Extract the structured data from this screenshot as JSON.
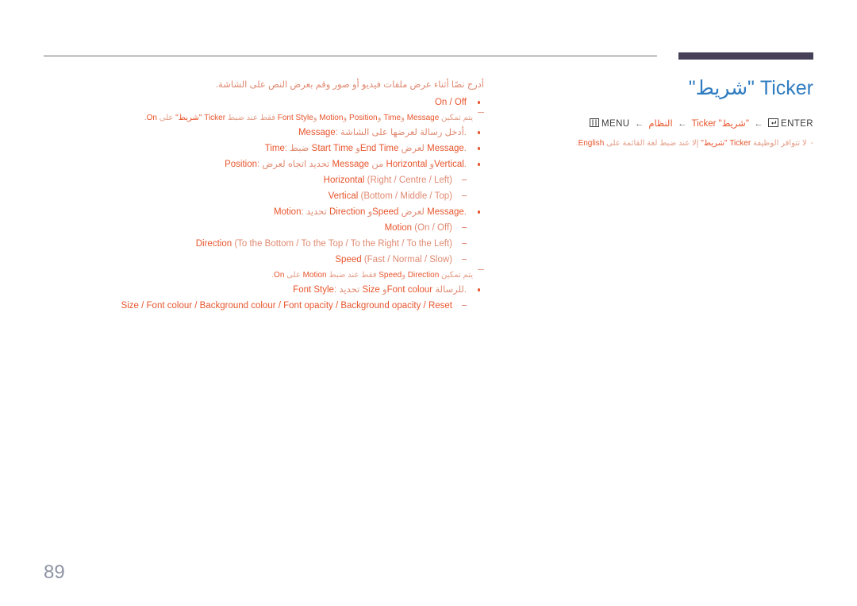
{
  "topbar": {
    "rule_name": "horizontal-rule",
    "tab_marker_color": "#464159",
    "rule_color": "#6f6b78"
  },
  "header": {
    "title": "Ticker \"شريط\"",
    "title_color": "#2f7cc0",
    "breadcrumb": {
      "menu_icon": "menu-icon",
      "menu_label": "MENU",
      "arrow": "←",
      "item_system": "النظام",
      "item_ticker": "Ticker \"شريط\"",
      "enter_icon": "enter-icon",
      "enter_label": "ENTER"
    },
    "note": {
      "dash": "-",
      "text_before": "لا تتوافر الوظيفة",
      "term_ticker": "Ticker \"شريط\"",
      "text_middle": "إلا عند ضبط لغة القائمة على",
      "term_english": "English",
      "text_after": "."
    }
  },
  "main": {
    "intro": "أدرج نصًا أثناء عرض ملفات فيديو أو صور وقم بعرض النص على الشاشة.",
    "items": [
      {
        "kind": "bullet",
        "label": "On / Off",
        "label_highlight": true,
        "text": ""
      },
      {
        "kind": "subnote",
        "segments": [
          {
            "t": "يتم تمكين ",
            "hl": false
          },
          {
            "t": "Message",
            "hl": true
          },
          {
            "t": " و",
            "hl": false
          },
          {
            "t": "Time",
            "hl": true
          },
          {
            "t": " و",
            "hl": false
          },
          {
            "t": "Position",
            "hl": true
          },
          {
            "t": " و",
            "hl": false
          },
          {
            "t": "Motion",
            "hl": true
          },
          {
            "t": " و",
            "hl": false
          },
          {
            "t": "Font Style",
            "hl": true
          },
          {
            "t": " فقط عند ضبط ",
            "hl": false
          },
          {
            "t": "Ticker \"شريط\"",
            "hl": true
          },
          {
            "t": " على ",
            "hl": false
          },
          {
            "t": "On",
            "hl": true
          },
          {
            "t": ".",
            "hl": false
          }
        ]
      },
      {
        "kind": "bullet",
        "segments": [
          {
            "t": "Message",
            "hl": true
          },
          {
            "t": ": أدخل رسالة لعرضها على الشاشة.",
            "hl": false
          }
        ]
      },
      {
        "kind": "bullet",
        "segments": [
          {
            "t": "Time",
            "hl": true
          },
          {
            "t": ": ضبط ",
            "hl": false
          },
          {
            "t": "Start Time",
            "hl": true
          },
          {
            "t": " و",
            "hl": false
          },
          {
            "t": "End Time",
            "hl": true
          },
          {
            "t": " لعرض ",
            "hl": false
          },
          {
            "t": "Message",
            "hl": true
          },
          {
            "t": ".",
            "hl": false
          }
        ]
      },
      {
        "kind": "bullet",
        "segments": [
          {
            "t": "Position",
            "hl": true
          },
          {
            "t": ": تحديد اتجاه لعرض ",
            "hl": false
          },
          {
            "t": "Message",
            "hl": true
          },
          {
            "t": " من ",
            "hl": false
          },
          {
            "t": "Horizontal",
            "hl": true
          },
          {
            "t": " و",
            "hl": false
          },
          {
            "t": "Vertical",
            "hl": true
          },
          {
            "t": ".",
            "hl": false
          }
        ]
      },
      {
        "kind": "dash",
        "label": "Horizontal",
        "options": "(Right / Centre / Left)"
      },
      {
        "kind": "dash",
        "label": "Vertical",
        "options": "(Bottom / Middle / Top)"
      },
      {
        "kind": "bullet",
        "segments": [
          {
            "t": "Motion",
            "hl": true
          },
          {
            "t": ": تحديد ",
            "hl": false
          },
          {
            "t": "Direction",
            "hl": true
          },
          {
            "t": " و",
            "hl": false
          },
          {
            "t": "Speed",
            "hl": true
          },
          {
            "t": " لعرض ",
            "hl": false
          },
          {
            "t": "Message",
            "hl": true
          },
          {
            "t": ".",
            "hl": false
          }
        ]
      },
      {
        "kind": "dash",
        "label": "Motion",
        "options": "(On / Off)"
      },
      {
        "kind": "dash",
        "label": "Direction",
        "options": "(To the Bottom / To the Top / To the Right / To the Left)"
      },
      {
        "kind": "dash",
        "label": "Speed",
        "options": "(Fast / Normal / Slow)"
      },
      {
        "kind": "subnote",
        "segments": [
          {
            "t": "يتم تمكين ",
            "hl": false
          },
          {
            "t": "Direction",
            "hl": true
          },
          {
            "t": " و",
            "hl": false
          },
          {
            "t": "Speed",
            "hl": true
          },
          {
            "t": " فقط عند ضبط ",
            "hl": false
          },
          {
            "t": "Motion",
            "hl": true
          },
          {
            "t": " على ",
            "hl": false
          },
          {
            "t": "On",
            "hl": true
          },
          {
            "t": ".",
            "hl": false
          }
        ]
      },
      {
        "kind": "bullet",
        "segments": [
          {
            "t": "Font Style",
            "hl": true
          },
          {
            "t": ": تحديد ",
            "hl": false
          },
          {
            "t": "Size",
            "hl": true
          },
          {
            "t": " و",
            "hl": false
          },
          {
            "t": "Font colour",
            "hl": true
          },
          {
            "t": " للرسالة.",
            "hl": false
          }
        ]
      },
      {
        "kind": "dash",
        "label": "",
        "options": "Size / Font colour / Background colour / Font opacity / Background opacity / Reset",
        "all_highlight": true
      }
    ]
  },
  "footer": {
    "page_number": "89",
    "page_number_color": "#8d93a3"
  },
  "colors": {
    "accent_orange": "#e8552d",
    "muted_orange": "#e08a72",
    "faint_orange": "#e39c86",
    "title_blue": "#2f7cc0",
    "rule": "#6f6b78",
    "tab": "#464159"
  }
}
